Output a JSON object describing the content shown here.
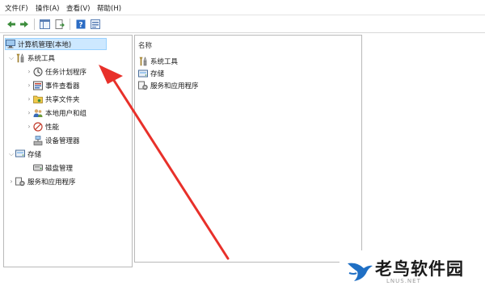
{
  "menu": {
    "file": "文件(F)",
    "action": "操作(A)",
    "view": "查看(V)",
    "help": "帮助(H)"
  },
  "toolbar": {
    "icons": [
      "back-arrow-icon",
      "forward-arrow-icon",
      "show-hide-tree-icon",
      "export-list-icon",
      "help-icon",
      "properties-icon"
    ]
  },
  "tree": {
    "root": {
      "label": "计算机管理(本地)",
      "icon": "computer-management-icon"
    },
    "system_tools": {
      "label": "系统工具",
      "icon": "tools-icon"
    },
    "system_children": [
      {
        "label": "任务计划程序",
        "icon": "clock-icon"
      },
      {
        "label": "事件查看器",
        "icon": "event-viewer-icon"
      },
      {
        "label": "共享文件夹",
        "icon": "shared-folder-icon"
      },
      {
        "label": "本地用户和组",
        "icon": "users-icon"
      },
      {
        "label": "性能",
        "icon": "performance-icon"
      },
      {
        "label": "设备管理器",
        "icon": "device-manager-icon"
      }
    ],
    "storage": {
      "label": "存储",
      "icon": "storage-icon"
    },
    "storage_children": [
      {
        "label": "磁盘管理",
        "icon": "disk-icon"
      }
    ],
    "services": {
      "label": "服务和应用程序",
      "icon": "services-icon"
    }
  },
  "list": {
    "column_name": "名称",
    "items": [
      {
        "label": "系统工具",
        "icon": "tools-icon"
      },
      {
        "label": "存储",
        "icon": "storage-icon"
      },
      {
        "label": "服务和应用程序",
        "icon": "services-icon"
      }
    ]
  },
  "annotation": {
    "color": "#e8302a"
  },
  "watermark": {
    "text": "老鸟软件园",
    "url": "LNUS.NET"
  },
  "colors": {
    "selection": "#cde8ff",
    "selection_border": "#99d1ff",
    "toolbar_blue": "#2b6cc4"
  }
}
